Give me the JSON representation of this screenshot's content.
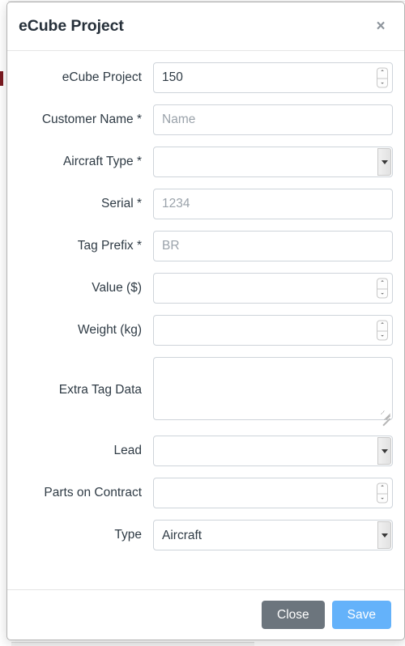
{
  "modal": {
    "title": "eCube Project",
    "close_icon": "close-icon",
    "close_glyph": "×"
  },
  "form": {
    "fields": [
      {
        "name": "ecube-project",
        "label": "eCube Project",
        "type": "number",
        "value": "150",
        "placeholder": "",
        "required": false
      },
      {
        "name": "customer-name",
        "label": "Customer Name *",
        "type": "text",
        "value": "",
        "placeholder": "Name",
        "required": true
      },
      {
        "name": "aircraft-type",
        "label": "Aircraft Type *",
        "type": "select",
        "value": "",
        "placeholder": "",
        "required": true
      },
      {
        "name": "serial",
        "label": "Serial *",
        "type": "text",
        "value": "",
        "placeholder": "1234",
        "required": true
      },
      {
        "name": "tag-prefix",
        "label": "Tag Prefix *",
        "type": "text",
        "value": "",
        "placeholder": "BR",
        "required": true
      },
      {
        "name": "value-dollars",
        "label": "Value ($)",
        "type": "number",
        "value": "",
        "placeholder": "",
        "required": false
      },
      {
        "name": "weight-kg",
        "label": "Weight (kg)",
        "type": "number",
        "value": "",
        "placeholder": "",
        "required": false
      },
      {
        "name": "extra-tag-data",
        "label": "Extra Tag Data",
        "type": "textarea",
        "value": "",
        "placeholder": "",
        "required": false
      },
      {
        "name": "lead",
        "label": "Lead",
        "type": "select",
        "value": "",
        "placeholder": "",
        "required": false
      },
      {
        "name": "parts-on-contract",
        "label": "Parts on Contract",
        "type": "number",
        "value": "",
        "placeholder": "",
        "required": false
      },
      {
        "name": "type",
        "label": "Type",
        "type": "select",
        "value": "Aircraft",
        "placeholder": "",
        "required": false
      }
    ]
  },
  "footer": {
    "close_label": "Close",
    "save_label": "Save"
  },
  "colors": {
    "save_button": "#64b2fa",
    "close_button": "#6c757d",
    "title_text": "#26303a",
    "border": "#ced4da"
  },
  "icons": {
    "spinner_up": "⌃",
    "spinner_down": "⌄"
  }
}
